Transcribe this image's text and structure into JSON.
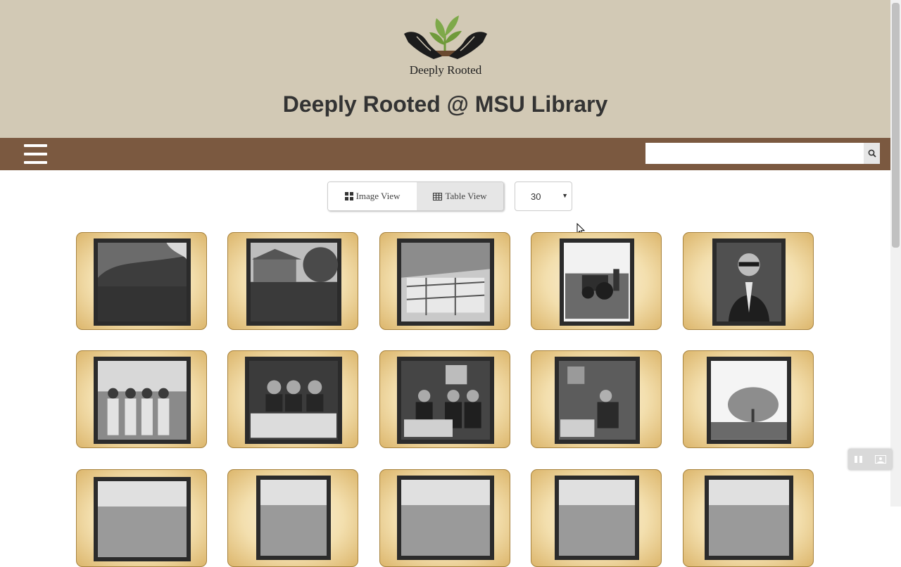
{
  "header": {
    "logo_text": "Deeply Rooted",
    "site_title": "Deeply Rooted @ MSU Library",
    "background": "#d2c9b5"
  },
  "navbar": {
    "background": "#7b5940",
    "menu_icon": "hamburger-icon",
    "search": {
      "value": "",
      "placeholder": "",
      "button_icon": "search-icon"
    }
  },
  "toolbar": {
    "image_view_label": "Image View",
    "image_view_icon": "grid-icon",
    "table_view_label": "Table View",
    "table_view_icon": "table-icon",
    "per_page": "30"
  },
  "gallery": {
    "tile_border_color": "#a7823d",
    "items": [
      {
        "subject": "field-landscape"
      },
      {
        "subject": "house-with-trees"
      },
      {
        "subject": "livestock-pen"
      },
      {
        "subject": "tractor-in-field"
      },
      {
        "subject": "man-portrait"
      },
      {
        "subject": "group-of-women-outdoors"
      },
      {
        "subject": "people-at-dinner-table"
      },
      {
        "subject": "men-at-table-indoors"
      },
      {
        "subject": "person-seated-in-room"
      },
      {
        "subject": "tree-in-field"
      },
      {
        "subject": "photo"
      },
      {
        "subject": "photo"
      },
      {
        "subject": "photo"
      },
      {
        "subject": "photo"
      },
      {
        "subject": "photo"
      }
    ]
  },
  "floating_controls": {
    "icons": [
      "pause-icon",
      "image-icon"
    ]
  }
}
